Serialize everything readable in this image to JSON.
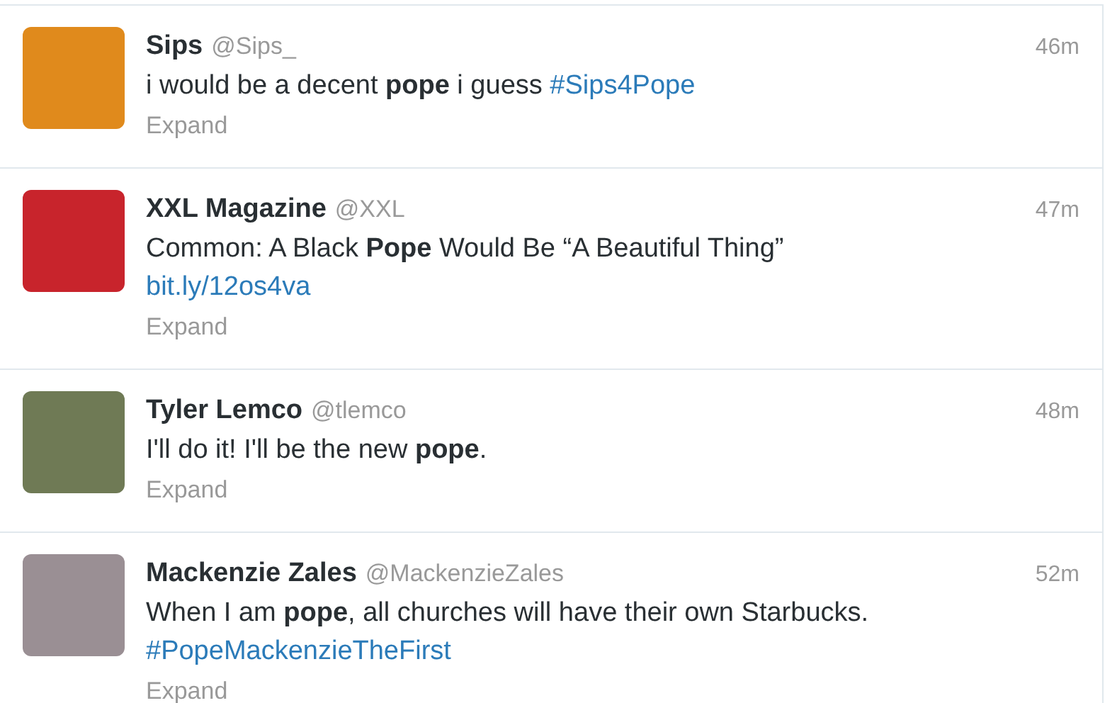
{
  "tweets": [
    {
      "name": "Sips",
      "handle": "@Sips_",
      "time": "46m",
      "lines": [
        [
          {
            "kind": "text",
            "text": "i would be a decent **pope** i guess "
          },
          {
            "kind": "link",
            "text": "#Sips4Pope"
          }
        ]
      ],
      "action": "Expand"
    },
    {
      "name": "XXL Magazine",
      "handle": "@XXL",
      "time": "47m",
      "lines": [
        [
          {
            "kind": "text",
            "text": "Common: A Black **Pope** Would Be “A Beautiful Thing”"
          }
        ],
        [
          {
            "kind": "link",
            "text": "bit.ly/12os4va"
          }
        ]
      ],
      "action": "Expand"
    },
    {
      "name": "Tyler Lemco",
      "handle": "@tlemco",
      "time": "48m",
      "lines": [
        [
          {
            "kind": "text",
            "text": "I'll do it! I'll be the new **pope**."
          }
        ]
      ],
      "action": "Expand"
    },
    {
      "name": "Mackenzie Zales",
      "handle": "@MackenzieZales",
      "time": "52m",
      "lines": [
        [
          {
            "kind": "text",
            "text": "When I am **pope**, all churches will have their own Starbucks."
          }
        ],
        [
          {
            "kind": "link",
            "text": "#PopeMackenzieTheFirst"
          }
        ]
      ],
      "action": "Expand"
    }
  ]
}
